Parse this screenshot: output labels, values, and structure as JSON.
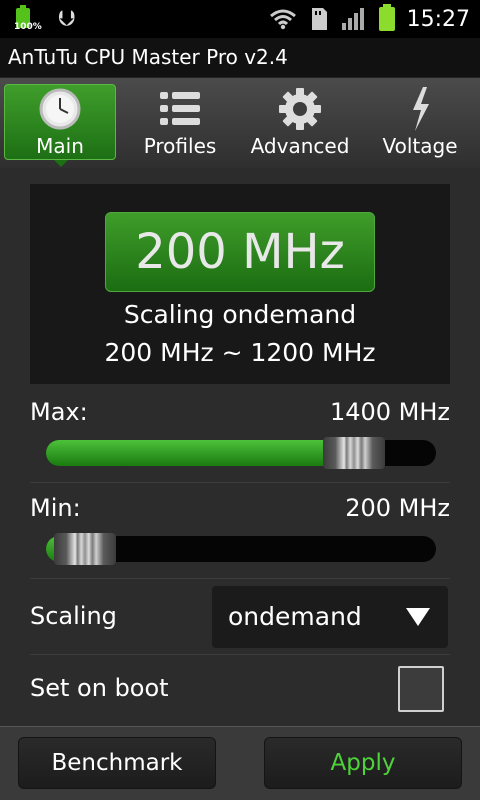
{
  "status_bar": {
    "battery_small_pct": "100%",
    "time": "15:27",
    "icons": [
      "battery-icon",
      "usb-icon",
      "wifi-icon",
      "sd-card-icon",
      "signal-icon",
      "battery-icon"
    ]
  },
  "app_title": "AnTuTu CPU Master Pro v2.4",
  "tabs": [
    {
      "label": "Main",
      "icon": "clock-icon",
      "active": true
    },
    {
      "label": "Profiles",
      "icon": "list-icon",
      "active": false
    },
    {
      "label": "Advanced",
      "icon": "gear-icon",
      "active": false
    },
    {
      "label": "Voltage",
      "icon": "lightning-icon",
      "active": false
    }
  ],
  "current": {
    "frequency": "200 MHz",
    "governor_line": "Scaling ondemand",
    "range_line": "200 MHz ~ 1200 MHz"
  },
  "max": {
    "label": "Max:",
    "value": "1400 MHz",
    "slider_fraction": 0.79
  },
  "min": {
    "label": "Min:",
    "value": "200 MHz",
    "slider_fraction": 0.1
  },
  "scaling": {
    "label": "Scaling",
    "selected": "ondemand"
  },
  "set_on_boot": {
    "label": "Set on boot",
    "checked": false
  },
  "buttons": {
    "benchmark": "Benchmark",
    "apply": "Apply"
  },
  "colors": {
    "accent_green": "#2a8a1c",
    "apply_text": "#4fd33a"
  }
}
